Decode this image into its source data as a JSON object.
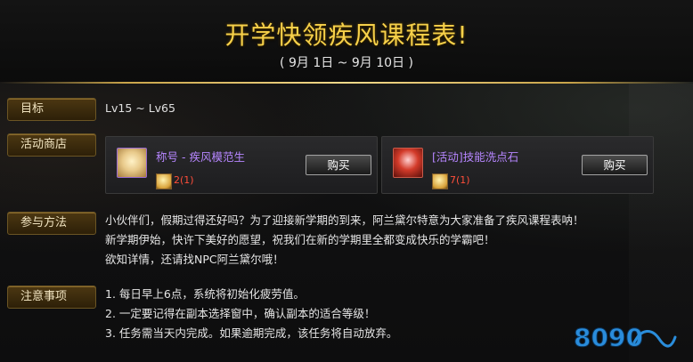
{
  "header": {
    "title": "开学快领疾风课程表!",
    "subtitle": "( 9月 1日 ~ 9月 10日 )"
  },
  "sections": {
    "target": {
      "label": "目标",
      "value": "Lv15 ~ Lv65"
    },
    "shop": {
      "label": "活动商店",
      "items": [
        {
          "name": "称号 - 疾风模范生",
          "button": "购买",
          "price": "2(1)",
          "icon": "scroll-icon"
        },
        {
          "name": "[活动]技能洗点石",
          "button": "购买",
          "price": "7(1)",
          "icon": "skill-stone-icon"
        }
      ]
    },
    "method": {
      "label": "参与方法",
      "lines": [
        "小伙伴们，假期过得还好吗？为了迎接新学期的到来，阿兰黛尔特意为大家准备了疾风课程表呐！",
        "新学期伊始，快许下美好的愿望，祝我们在新的学期里全都变成快乐的学霸吧！",
        "欲知详情，还请找NPC阿兰黛尔哦！"
      ]
    },
    "notes": {
      "label": "注意事项",
      "lines": [
        "1. 每日早上6点，系统将初始化疲劳值。",
        "2. 一定要记得在副本选择窗中，确认副本的适合等级！",
        "3. 任务需当天内完成。如果逾期完成，该任务将自动放弃。"
      ]
    }
  },
  "watermark": {
    "text": "8090"
  },
  "colors": {
    "title_gold": "#f7d14a",
    "label_bg": "#4c3712",
    "item_name_purple": "#b686ff",
    "price_red": "#ff4e3a"
  }
}
